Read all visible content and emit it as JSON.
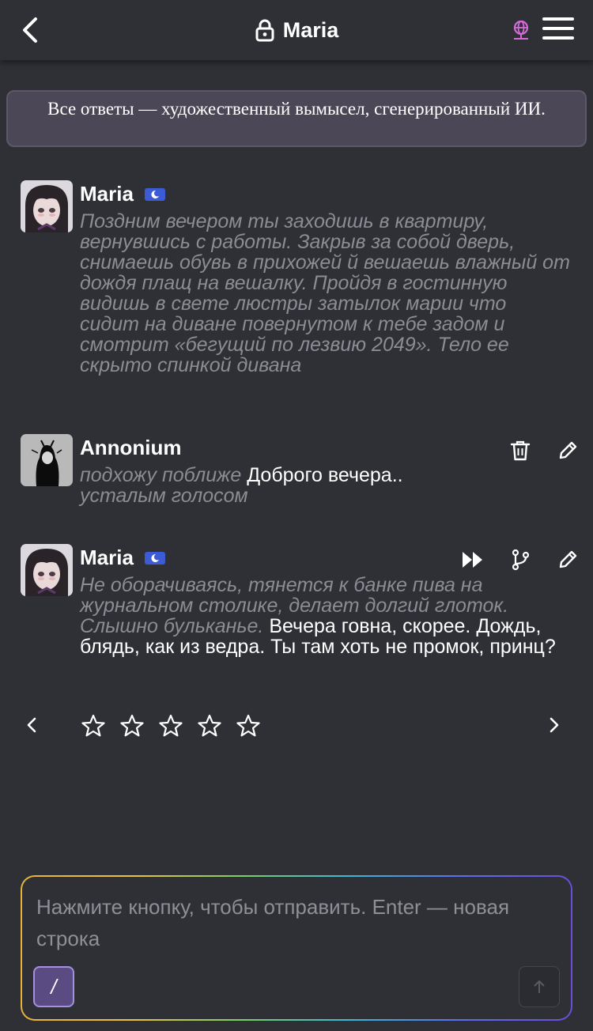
{
  "header": {
    "title": "Maria"
  },
  "disclaimer": "Все ответы — художественный вымысел, сгенерированный ИИ.",
  "messages": [
    {
      "name": "Maria",
      "italic": "Поздним вечером ты заходишь в квартиру, вернувшись с работы. Закрыв за собой дверь, снимаешь обувь в прихожей й вешаешь влажный от дождя плащ на вешалку. Пройдя в гостинную видишь в свете люстры затылок марии что сидит на диване повернутом к тебе задом и смотрит «бегущий по лезвию 2049». Тело ее скрыто спинкой дивана",
      "text": ""
    },
    {
      "name": "Annonium",
      "italic": "подхожу поближе",
      "text": "Доброго вечера..",
      "italic2": "усталым голосом"
    },
    {
      "name": "Maria",
      "italic": "Не оборачиваясь, тянется к банке пива на журнальном столике, делает долгий глоток. Слышно бульканье.",
      "text": "Вечера говна, скорее. Дождь, блядь, как из ведра. Ты там хоть не промок, принц?"
    }
  ],
  "rating": {
    "stars_total": 5,
    "stars_filled": 0
  },
  "composer": {
    "placeholder": "Нажмите кнопку, чтобы отправить. Enter — новая строка",
    "slash_label": "/"
  },
  "icons": {
    "back": "chevron-left-icon",
    "lock": "lock-icon",
    "globe": "globe-icon",
    "menu": "hamburger-menu-icon",
    "delete": "trash-icon",
    "edit": "pencil-icon",
    "continue": "fast-forward-icon",
    "branch": "branch-icon",
    "send": "arrow-up-icon"
  },
  "colors": {
    "background": "#2e3035",
    "disclaimer_bg": "#4b4757",
    "italic_text": "#8c8c93",
    "badge": "#3c5bd6",
    "globe": "#d46bd8",
    "slash_button": "#5a4c83"
  }
}
